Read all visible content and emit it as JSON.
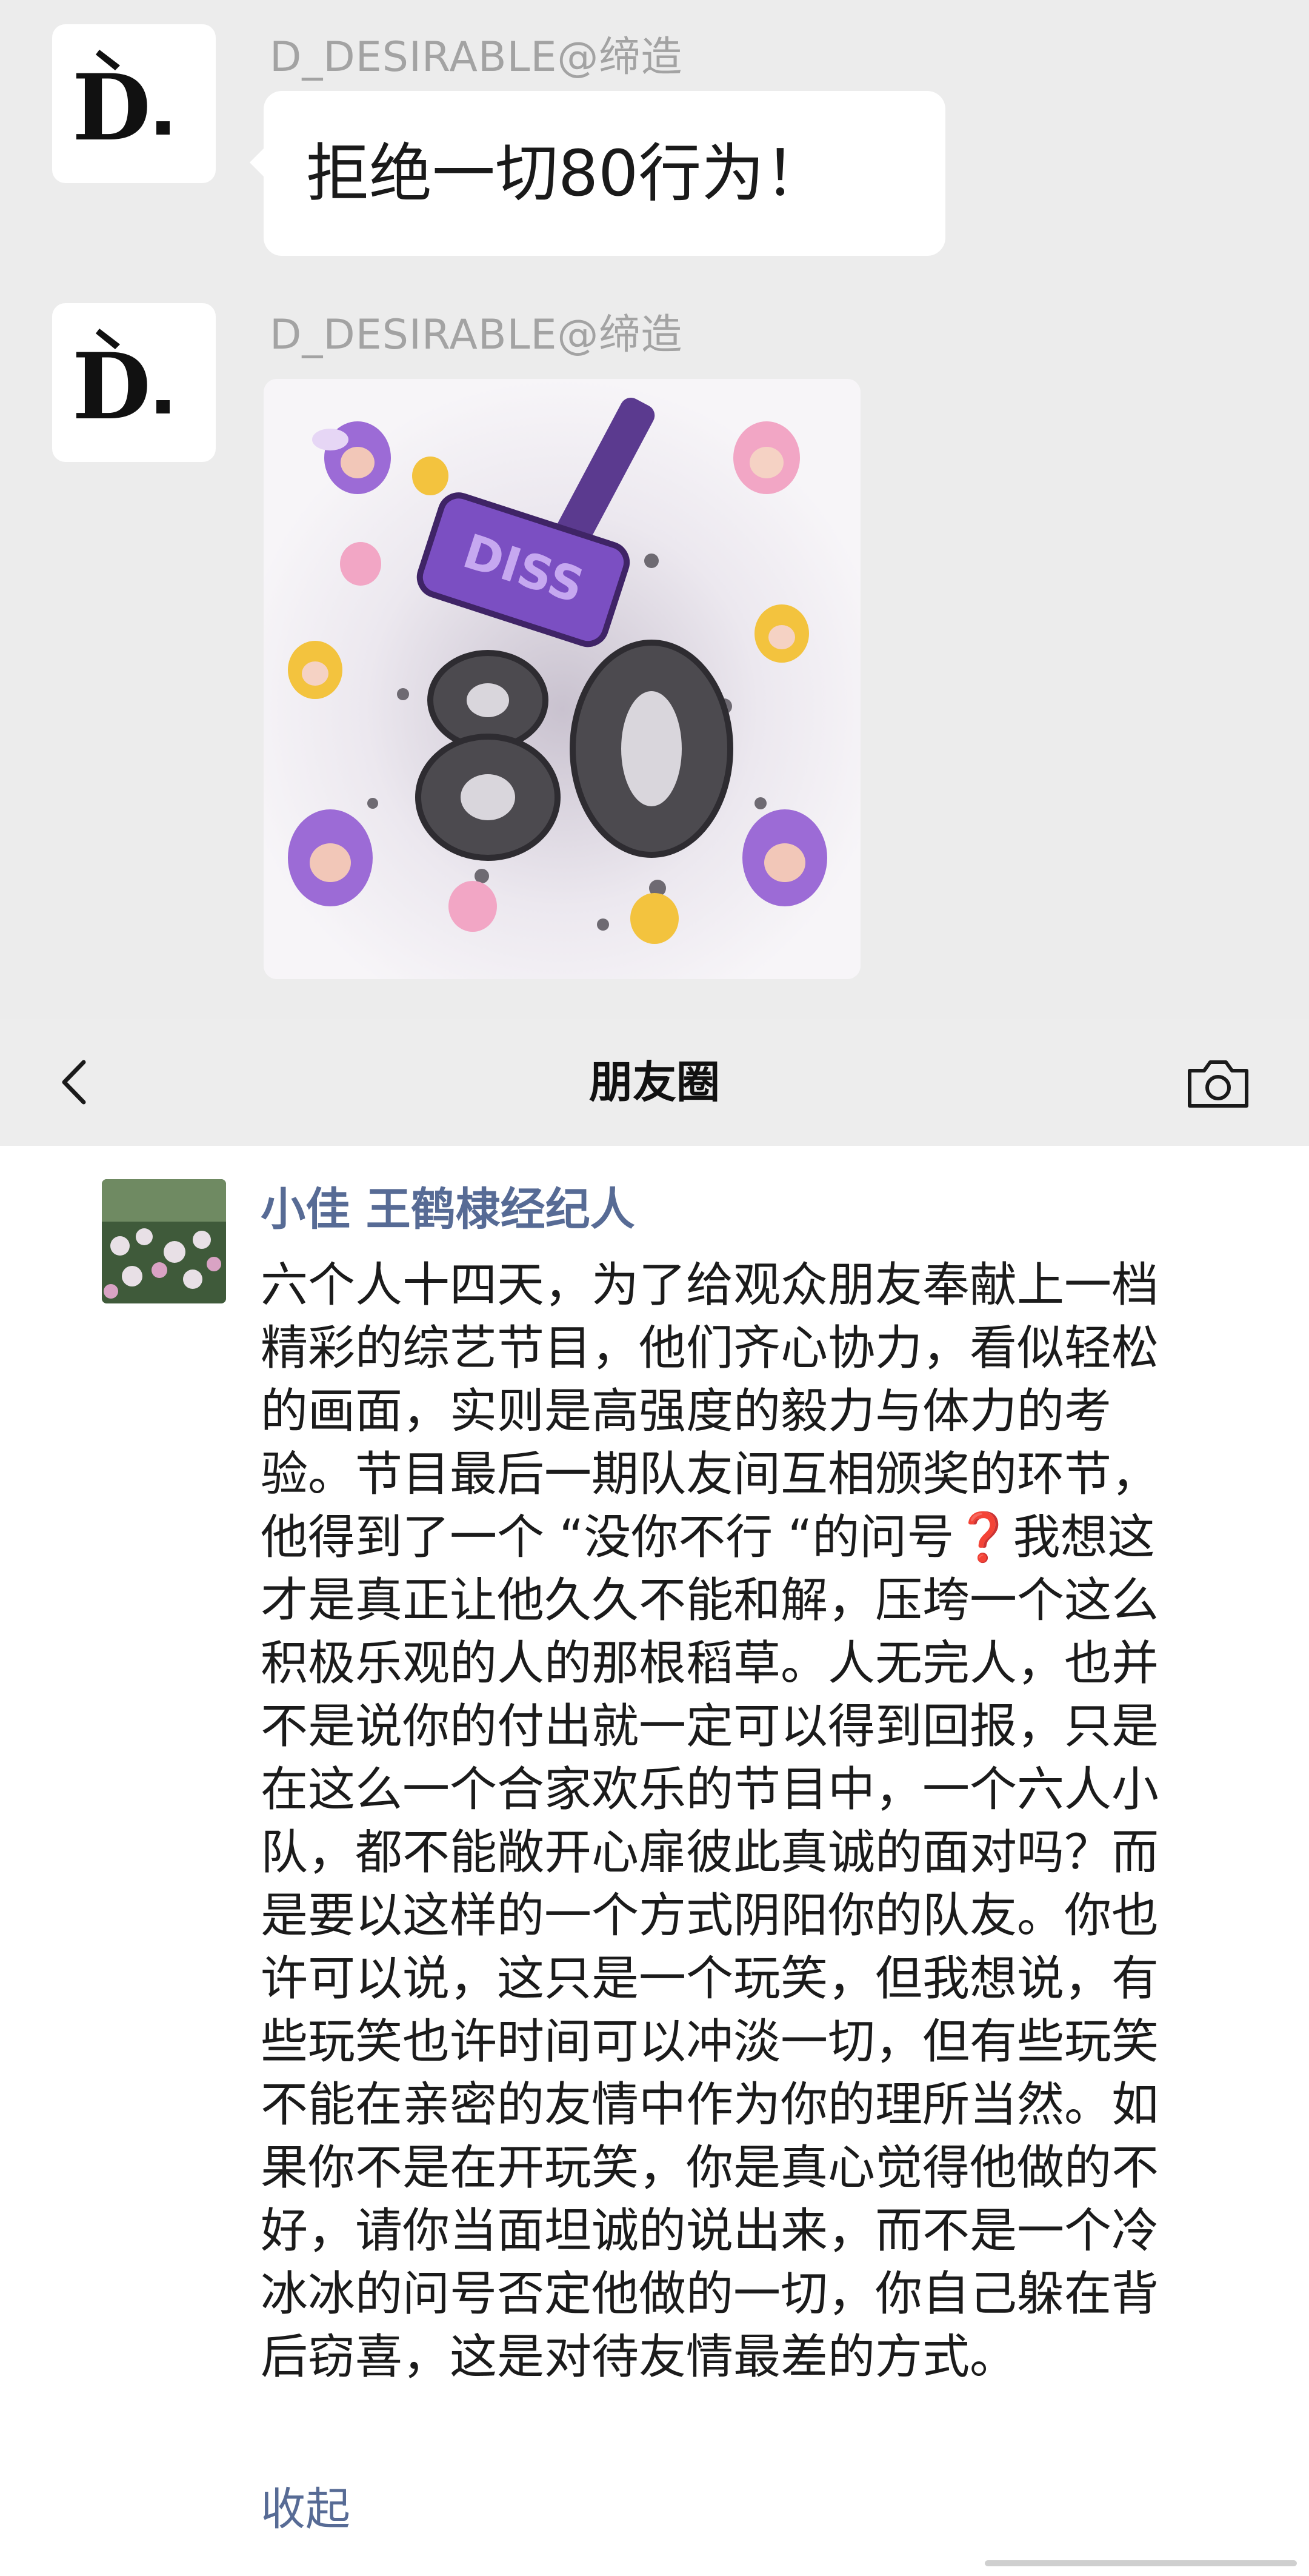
{
  "chat": {
    "messages": [
      {
        "sender": "D_DESIRABLE@缔造",
        "avatar_text": "D.",
        "text": "拒绝一切80行为！"
      },
      {
        "sender": "D_DESIRABLE@缔造",
        "avatar_text": "D.",
        "sticker_label": "DISS",
        "sticker_number": "80"
      }
    ]
  },
  "header": {
    "title": "朋友圈",
    "back_icon": "chevron-left-icon",
    "camera_icon": "camera-icon"
  },
  "post": {
    "author": "小佳 王鹤棣经纪人",
    "lines": [
      "六个人十四天，为了给观众朋友奉献上一档",
      "精彩的综艺节目，他们齐心协力，看似轻松",
      "的画面，实则是高强度的毅力与体力的考",
      "验。节目最后一期队友间互相颁奖的环节，",
      "他得到了一个 “没你不行 “的问号",
      "才是真正让他久久不能和解，压垮一个这么",
      "积极乐观的人的那根稻草。人无完人，也并",
      "不是说你的付出就一定可以得到回报，只是",
      "在这么一个合家欢乐的节目中，一个六人小",
      "队，都不能敞开心扉彼此真诚的面对吗？而",
      "是要以这样的一个方式阴阳你的队友。你也",
      "许可以说，这只是一个玩笑，但我想说，有",
      "些玩笑也许时间可以冲淡一切，但有些玩笑",
      "不能在亲密的友情中作为你的理所当然。如",
      "果你不是在开玩笑，你是真心觉得他做的不",
      "好，请你当面坦诚的说出来，而不是一个冷",
      "冰冰的问号否定他做的一切，你自己躲在背",
      "后窃喜，这是对待友情最差的方式。"
    ],
    "line5_emoji": "❓",
    "line5_tail": "我想这",
    "collapse_label": "收起"
  },
  "colors": {
    "link": "#576b95",
    "chat_bg": "#ececec",
    "header_bg": "#ededed",
    "qmark": "#e0242f"
  }
}
